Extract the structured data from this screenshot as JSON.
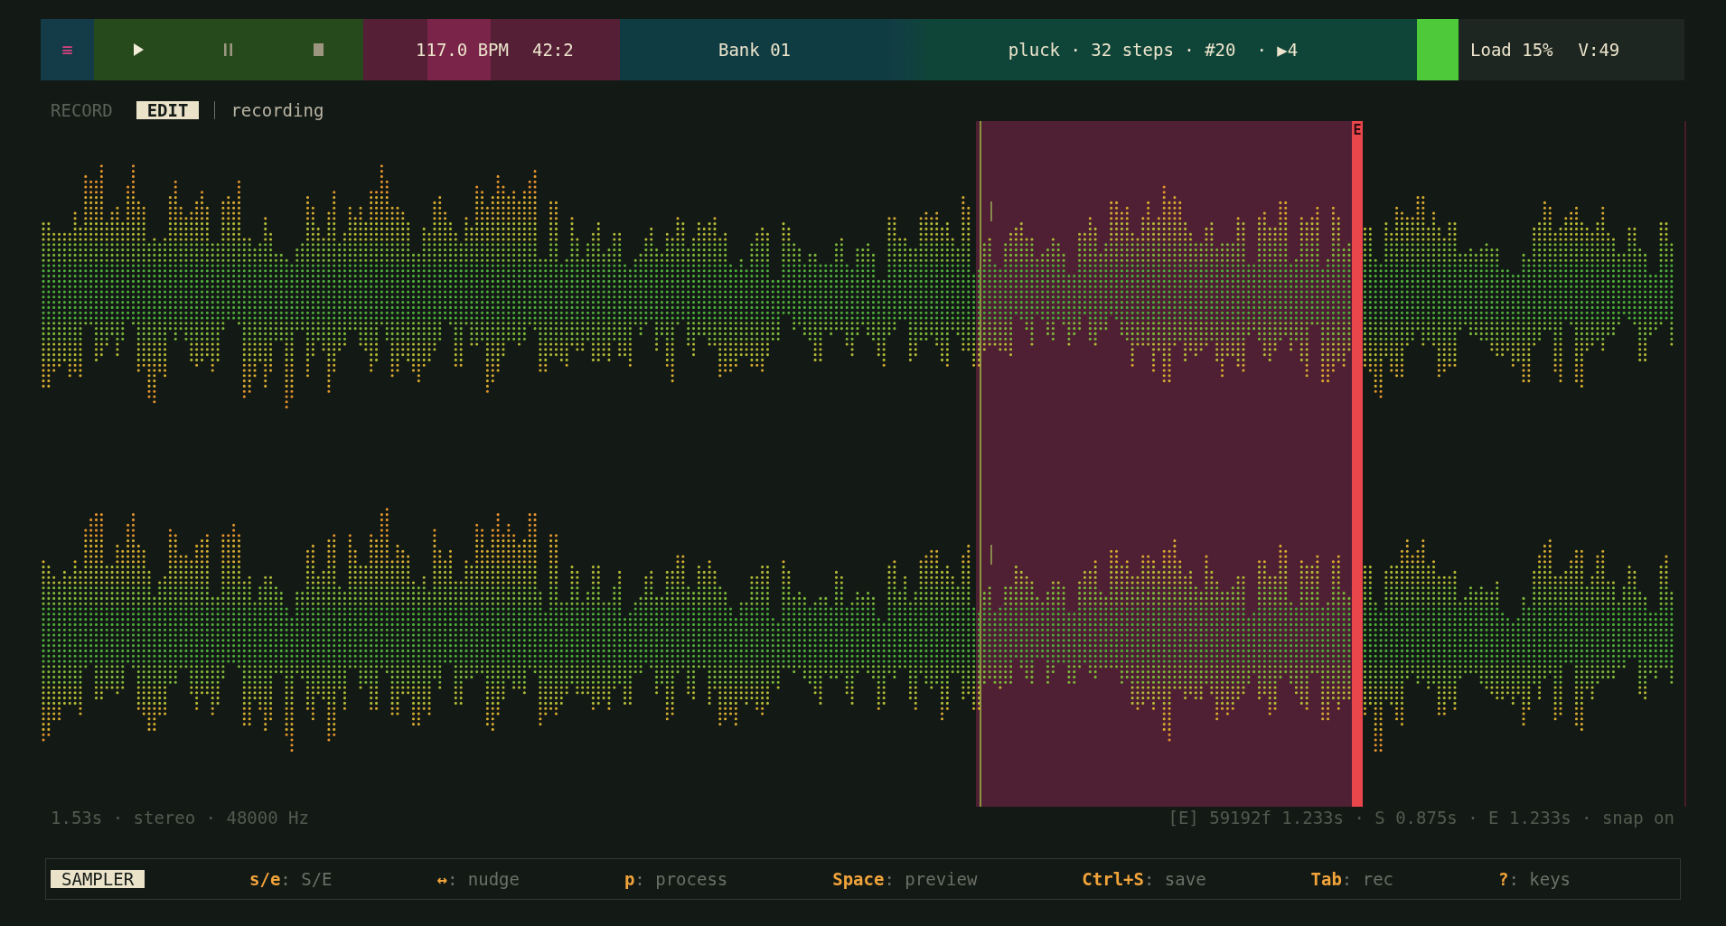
{
  "top_bar": {
    "menu_button": {
      "label": "≡"
    },
    "transport": [
      {
        "kind": "play",
        "active": true
      },
      {
        "kind": "pause",
        "active": false
      },
      {
        "kind": "stop",
        "active": false
      }
    ],
    "tempo": {
      "bpm": "117.0 BPM",
      "position": "42:2",
      "beat_flash": true
    },
    "bank": {
      "name": "Bank 01"
    },
    "pattern": {
      "info": "pluck · 32 steps · #20  · ▶4"
    },
    "load": {
      "cpu": "Load 15%",
      "voices": "V:49"
    }
  },
  "mode_tabs": [
    {
      "label": "RECORD",
      "selected": false
    },
    {
      "label": "EDIT",
      "selected": true
    }
  ],
  "status": "recording",
  "editor": {
    "end_marker": {
      "label": "E"
    }
  },
  "info": {
    "left": "1.53s · stereo · 48000 Hz",
    "right": "[E] 59192f 1.233s · S 0.875s · E 1.233s · snap on"
  },
  "status_bar": {
    "mode": "SAMPLER",
    "hints": [
      "**s/e**: S/E",
      "**↔**: nudge",
      "**p**: process",
      "**Space**: preview",
      "**Ctrl+S**: save",
      "**Tab**: rec",
      "**?**: keys"
    ]
  }
}
